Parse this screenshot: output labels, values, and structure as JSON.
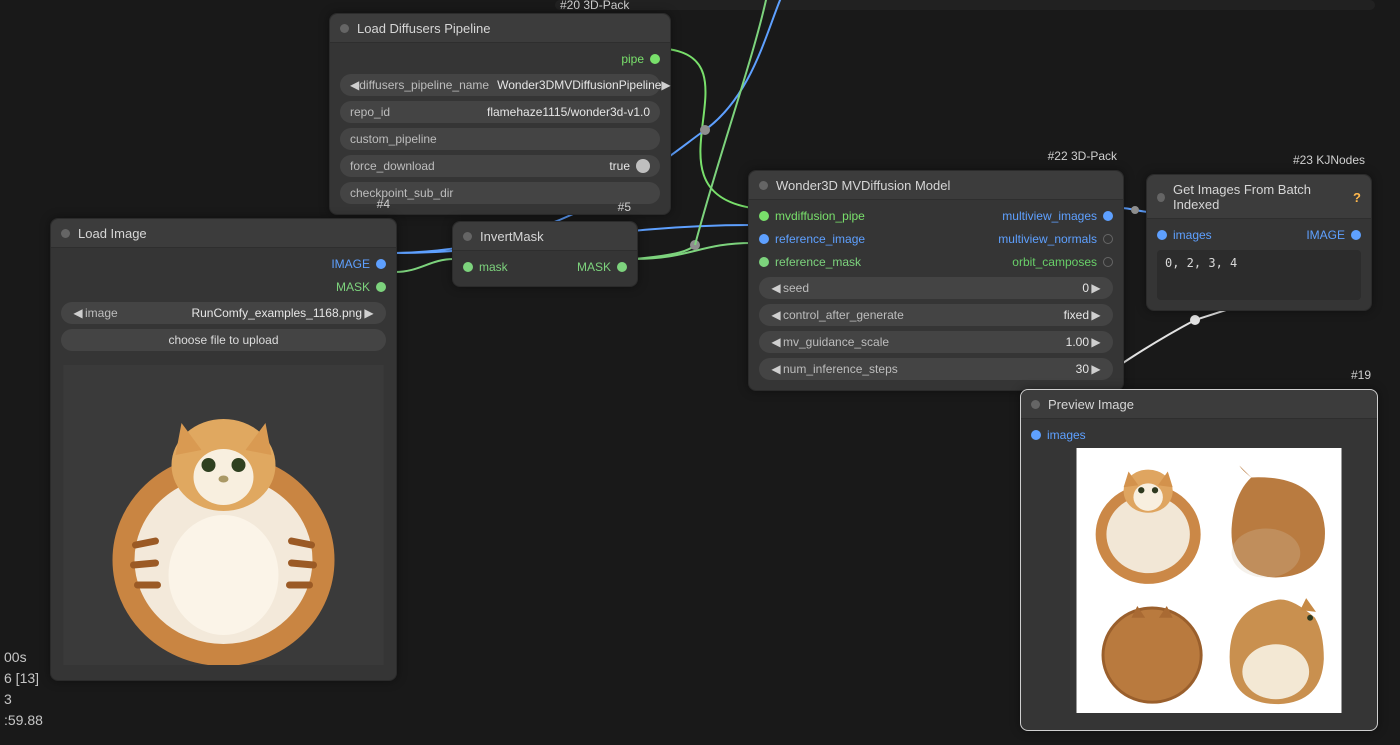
{
  "badges": {
    "top": "#20 3D-Pack",
    "loadimg": "#4",
    "invert": "#5",
    "wonder": "#22 3D-Pack",
    "batch": "#23 KJNodes",
    "preview": "#19"
  },
  "nodes": {
    "loaddiff": {
      "title": "Load Diffusers Pipeline",
      "out_pipe": "pipe",
      "widgets": {
        "pipeline_name_label": "diffusers_pipeline_name",
        "pipeline_name_value": "Wonder3DMVDiffusionPipeline",
        "repo_id_label": "repo_id",
        "repo_id_value": "flamehaze1115/wonder3d-v1.0",
        "custom_pipeline_label": "custom_pipeline",
        "force_download_label": "force_download",
        "force_download_value": "true",
        "ckpt_sub_dir_label": "checkpoint_sub_dir"
      }
    },
    "loadimg": {
      "title": "Load Image",
      "out_image": "IMAGE",
      "out_mask": "MASK",
      "widgets": {
        "image_label": "image",
        "image_value": "RunComfy_examples_1168.png",
        "upload_btn": "choose file to upload"
      }
    },
    "invert": {
      "title": "InvertMask",
      "in_mask": "mask",
      "out_mask": "MASK"
    },
    "wonder": {
      "title": "Wonder3D MVDiffusion Model",
      "in_pipe": "mvdiffusion_pipe",
      "in_ref_image": "reference_image",
      "in_ref_mask": "reference_mask",
      "out_mv_images": "multiview_images",
      "out_mv_normals": "multiview_normals",
      "out_orbit": "orbit_camposes",
      "widgets": {
        "seed_label": "seed",
        "seed_value": "0",
        "ctrl_after_label": "control_after_generate",
        "ctrl_after_value": "fixed",
        "guidance_label": "mv_guidance_scale",
        "guidance_value": "1.00",
        "steps_label": "num_inference_steps",
        "steps_value": "30"
      }
    },
    "batch": {
      "title": "Get Images From Batch Indexed",
      "in_images": "images",
      "out_image": "IMAGE",
      "textbox": "0, 2, 3, 4"
    },
    "preview": {
      "title": "Preview Image",
      "in_images": "images"
    }
  },
  "hud": {
    "l1": "00s",
    "l2": "6 [13]",
    "l3": "3",
    "l4": ":59.88"
  },
  "arrows": {
    "left": "◀",
    "right": "▶"
  }
}
